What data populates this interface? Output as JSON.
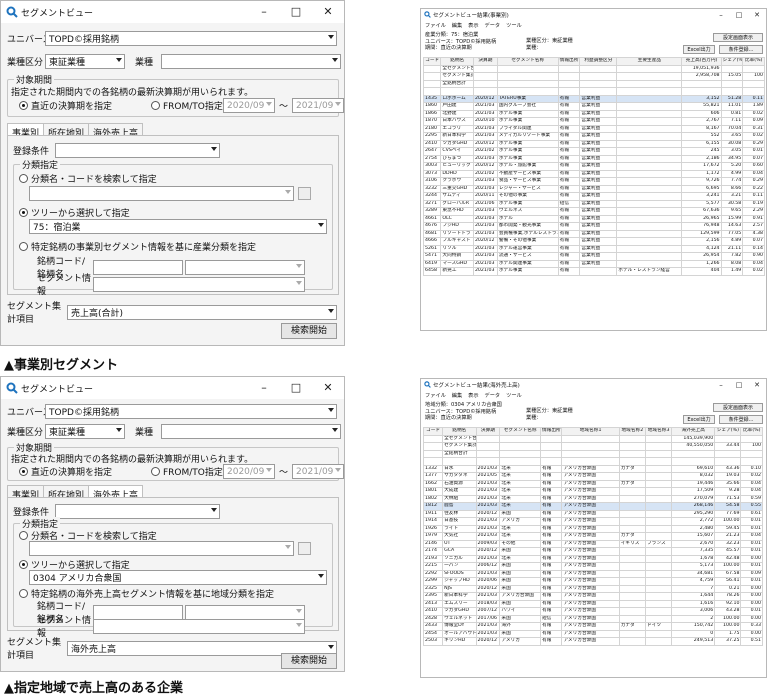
{
  "colors": {
    "window_bg": "#f4f4f4",
    "title_icon": "#1e73be",
    "selected_row": "#d6e4f5"
  },
  "icons": {
    "app": "magnifier-icon",
    "minimize": "minimize-icon",
    "maximize": "maximize-icon",
    "close": "close-icon"
  },
  "dialog1": {
    "title": "セグメントビュー",
    "universe_label": "ユニバース",
    "universe_value": "TOPD©採用銘柄",
    "sector_class_label": "業種区分",
    "sector_class_value": "東証業種",
    "sector_label": "業種",
    "sector_value": "",
    "period_group": "対象期間",
    "period_desc": "指定された期間内での各銘柄の最新決算期が用いられます。",
    "radio_latest": "直近の決算期を指定",
    "radio_fromto": "FROM/TO指定",
    "from_value": "2020/09",
    "tilde": "～",
    "to_value": "2021/09",
    "tabs": [
      "事業別",
      "所在地別",
      "海外売上高"
    ],
    "reg_cond_label": "登録条件",
    "class_group": "分類指定",
    "radio_search": "分類名・コードを検索して指定",
    "radio_tree": "ツリーから選択して指定",
    "tree_value": "75：宿泊業",
    "radio_specific": "特定銘柄の事業別セグメント情報を基に産業分類を指定",
    "code_label": "銘柄コード/銘柄名",
    "seg_info_label": "セグメント情報",
    "agg_label": "セグメント集計項目",
    "agg_value": "売上高(合計)",
    "search_button": "検索開始"
  },
  "caption1": "▲事業別セグメント",
  "dialog2": {
    "title": "セグメントビュー",
    "universe_label": "ユニバース",
    "universe_value": "TOPD©採用銘柄",
    "sector_class_label": "業種区分",
    "sector_class_value": "東証業種",
    "sector_label": "業種",
    "sector_value": "",
    "period_group": "対象期間",
    "period_desc": "指定された期間内での各銘柄の最新決算期が用いられます。",
    "radio_latest": "直近の決算期を指定",
    "radio_fromto": "FROM/TO指定",
    "from_value": "2020/09",
    "tilde": "～",
    "to_value": "2021/09",
    "tabs": [
      "事業別",
      "所在地別",
      "海外売上高"
    ],
    "reg_cond_label": "登録条件",
    "class_group": "分類指定",
    "radio_search": "分類名・コードを検索して指定",
    "radio_tree": "ツリーから選択して指定",
    "tree_value": "0304 アメリカ合衆国",
    "radio_specific": "特定銘柄の海外売上高セグメント情報を基に地域分類を指定",
    "code_label": "銘柄コード/銘柄名",
    "seg_info_label": "セグメント情報",
    "agg_label": "セグメント集計項目",
    "agg_value": "海外売上高",
    "search_button": "検索開始"
  },
  "caption2": "▲指定地域で売上高のある企業",
  "result1": {
    "title": "セグメントビュー結果(事業別)",
    "menu": [
      "ファイル",
      "編集",
      "表示",
      "データ",
      "ツール"
    ],
    "info": [
      "産業分類：75：宿泊業",
      "ユニバース：TOPD©採用銘柄",
      "期間：直近の決算期"
    ],
    "info2": [
      "業種区分：東証業種",
      "業種："
    ],
    "btn_settings": "設定画面表示",
    "btn_excel": "Excel出力",
    "btn_cond": "条件登録...",
    "header": [
      "コード",
      "銘柄名",
      "決算期",
      "セグメント名称",
      "情報出所",
      "利益調整区分",
      "主要生産品",
      "売上高(百万円)",
      "シェア(%)",
      "比率(%)"
    ],
    "summary": [
      [
        "全セグメント合計",
        "19,051,936",
        "",
        ""
      ],
      [
        "セグメント集計合計",
        "2,958,708",
        "15.05",
        "100"
      ],
      [
        "全銘柄合計",
        "",
        "",
        ""
      ]
    ],
    "rows": [
      [
        "1435",
        "ロボホーム",
        "2020/12",
        "TATERU事業",
        "有報",
        "営業利益",
        "",
        "3,152",
        "51.28",
        "0.11"
      ],
      [
        "1860",
        "戸田建",
        "2021/03",
        "国内グループ会社",
        "有報",
        "営業利益",
        "",
        "55,821",
        "11.01",
        "1.89"
      ],
      [
        "1866",
        "北野建",
        "2021/03",
        "ホテル事業",
        "有報",
        "営業利益",
        "",
        "606",
        "0.81",
        "0.02"
      ],
      [
        "1870",
        "日本ハウス",
        "2020/10",
        "ホテル事業",
        "有報",
        "営業利益",
        "",
        "2,767",
        "7.11",
        "0.09"
      ],
      [
        "2180",
        "エコラリ",
        "2021/03",
        "ブライダル関連",
        "有報",
        "営業利益",
        "",
        "8,167",
        "70.04",
        "0.31"
      ],
      [
        "2295",
        "新日本科学",
        "2021/03",
        "メディカルリゾート事業",
        "有報",
        "営業利益",
        "",
        "552",
        "3.65",
        "0.02"
      ],
      [
        "2410",
        "ツガダGHD",
        "2020/12",
        "ホテル事業",
        "有報",
        "営業利益",
        "",
        "6,155",
        "30.08",
        "0.29"
      ],
      [
        "2647",
        "CVSベイ",
        "2021/02",
        "ホテル事業",
        "有報",
        "営業利益",
        "",
        "245",
        "3.05",
        "0.01"
      ],
      [
        "2754",
        "ひらまつ",
        "2021/03",
        "ホテル事業",
        "有報",
        "営業利益",
        "",
        "2,186",
        "34.95",
        "0.07"
      ],
      [
        "3003",
        "ヒューリック",
        "2020/12",
        "ホテル・旅館事業",
        "有報",
        "営業利益",
        "",
        "17,672",
        "5.20",
        "0.60"
      ],
      [
        "3073",
        "DDHD",
        "2021/02",
        "不動産サービス事業",
        "有報",
        "営業利益",
        "",
        "1,172",
        "4.99",
        "0.04"
      ],
      [
        "3106",
        "クラボウ",
        "2021/03",
        "食品・サービス事業",
        "有報",
        "営業利益",
        "",
        "9,726",
        "7.74",
        "0.29"
      ],
      [
        "3232",
        "三重交GHD",
        "2021/03",
        "レジャー・サービス",
        "有報",
        "営業利益",
        "",
        "6,695",
        "8.66",
        "0.22"
      ],
      [
        "3244",
        "サムティ",
        "2020/11",
        "その他の事業",
        "有報",
        "営業利益",
        "",
        "3,241",
        "3.21",
        "0.11"
      ],
      [
        "3271",
        "グローバルR",
        "2021/06",
        "ホテル事業",
        "短信",
        "営業利益",
        "",
        "5,577",
        "30.58",
        "0.19"
      ],
      [
        "3289",
        "東急不HD",
        "2021/03",
        "ウェルネス",
        "有報",
        "営業利益",
        "",
        "67,636",
        "9.65",
        "2.29"
      ],
      [
        "4661",
        "OLC",
        "2021/03",
        "ホテル",
        "有報",
        "営業利益",
        "",
        "26,965",
        "15.99",
        "0.91"
      ],
      [
        "4676",
        "フジHD",
        "2021/03",
        "都市開発・観光事業",
        "有報",
        "営業利益",
        "",
        "76,948",
        "14.63",
        "2.57"
      ],
      [
        "4681",
        "リゾートトラ",
        "2021/03",
        "会員権事業,ホテルレストラン",
        "有報",
        "営業利益",
        "",
        "129,599",
        "77.05",
        "4.38"
      ],
      [
        "4666",
        "フルキャスト",
        "2020/12",
        "警備・その他事業",
        "有報",
        "営業利益",
        "",
        "2,156",
        "4.89",
        "0.07"
      ],
      [
        "5261",
        "リソル",
        "2021/03",
        "ホテル運営事業",
        "有報",
        "営業利益",
        "",
        "4,124",
        "21.11",
        "0.14"
      ],
      [
        "5471",
        "大同特鋼",
        "2021/03",
        "流通・サービス",
        "有報",
        "営業利益",
        "",
        "26,954",
        "7.82",
        "0.90"
      ],
      [
        "6419",
        "マースGHD",
        "2021/03",
        "ホテル関連事業",
        "有報",
        "営業利益",
        "",
        "1,266",
        "8.08",
        "0.04"
      ],
      [
        "6458",
        "新晃工",
        "2021/03",
        "ホテル事業",
        "有報",
        "",
        "ホテル・レストラン経営",
        "404",
        "1.49",
        "0.02"
      ]
    ]
  },
  "result2": {
    "title": "セグメントビュー結果(海外売上高)",
    "menu": [
      "ファイル",
      "編集",
      "表示",
      "データ",
      "ツール"
    ],
    "info": [
      "地域分類：0304 アメリカ合衆国",
      "ユニバース：TOPD©採用銘柄",
      "期間：直近の決算期"
    ],
    "info2": [
      "業種区分：東証業種",
      "業種："
    ],
    "btn_settings": "設定画面表示",
    "btn_excel": "Excel出力",
    "btn_cond": "条件登録...",
    "header": [
      "コード",
      "銘柄名",
      "決算期",
      "セグメント名称",
      "情報出所",
      "地域名称1",
      "地域名称2",
      "地域名称3",
      "海外売上高",
      "シェア(%)",
      "比率(%)"
    ],
    "summary": [
      [
        "全セグメント合計",
        "145,039,900",
        "",
        ""
      ],
      [
        "セグメント集計合計",
        "40,550,050",
        "33.44",
        "100"
      ],
      [
        "全銘柄合計",
        "",
        "",
        ""
      ]
    ],
    "rows": [
      [
        "1332",
        "日水",
        "2021/03",
        "北米",
        "有報",
        "アメリカ合衆国",
        "カナダ",
        "",
        "69,610",
        "43.36",
        "0.10"
      ],
      [
        "1377",
        "サカタタネ",
        "2021/05",
        "北米",
        "有報",
        "アメリカ合衆国",
        "",
        "",
        "8,032",
        "19.03",
        "0.02"
      ],
      [
        "1662",
        "石油資源",
        "2021/03",
        "北米",
        "有報",
        "アメリカ合衆国",
        "カナダ",
        "",
        "19,446",
        "35.66",
        "0.04"
      ],
      [
        "1801",
        "大成建",
        "2021/03",
        "北米",
        "有報",
        "アメリカ合衆国",
        "",
        "",
        "17,509",
        "9.28",
        "0.04"
      ],
      [
        "1802",
        "大林組",
        "2021/03",
        "北米",
        "有報",
        "アメリカ合衆国",
        "",
        "",
        "270,079",
        "71.53",
        "0.59"
      ],
      [
        "1812",
        "鹿島",
        "2021/03",
        "北米",
        "有報",
        "アメリカ合衆国",
        "",
        "",
        "268,146",
        "54.58",
        "0.55"
      ],
      [
        "1911",
        "住友林",
        "2020/12",
        "米国",
        "有報",
        "アメリカ合衆国",
        "",
        "",
        "295,290",
        "77.69",
        "0.61"
      ],
      [
        "1914",
        "日基技",
        "2021/03",
        "アメリカ",
        "有報",
        "アメリカ合衆国",
        "",
        "",
        "2,772",
        "100.00",
        "0.01"
      ],
      [
        "1926",
        "ライト",
        "2021/03",
        "北米",
        "有報",
        "アメリカ合衆国",
        "",
        "",
        "2,480",
        "59.45",
        "0.01"
      ],
      [
        "1979",
        "大気社",
        "2021/03",
        "北米",
        "有報",
        "アメリカ合衆国",
        "カナダ",
        "",
        "15,607",
        "21.23",
        "0.04"
      ],
      [
        "2146",
        "UT",
        "2009/03",
        "その他",
        "有報",
        "アメリカ合衆国",
        "イギリス",
        "フランス",
        "2,670",
        "32.23",
        "0.01"
      ],
      [
        "2174",
        "GCA",
        "2020/12",
        "米国",
        "有報",
        "アメリカ合衆国",
        "",
        "",
        "7,335",
        "45.57",
        "0.01"
      ],
      [
        "2193",
        "ソニカル",
        "2021/03",
        "北米",
        "有報",
        "アメリカ合衆国",
        "",
        "",
        "1,678",
        "42.48",
        "0.00"
      ],
      [
        "2215",
        "一パン",
        "2006/12",
        "米国",
        "有報",
        "アメリカ合衆国",
        "",
        "",
        "5,173",
        "100.00",
        "0.01"
      ],
      [
        "2292",
        "SFOODS",
        "2021/03",
        "米国",
        "有報",
        "アメリカ合衆国",
        "",
        "",
        "34,681",
        "67.58",
        "0.09"
      ],
      [
        "2299",
        "ジャップHD",
        "2020/06",
        "米国",
        "有報",
        "アメリカ合衆国",
        "",
        "",
        "4,759",
        "56.41",
        "0.01"
      ],
      [
        "2325",
        "NJS",
        "2020/12",
        "米国",
        "有報",
        "アメリカ合衆国",
        "",
        "",
        "7",
        "0.21",
        "0.00"
      ],
      [
        "2395",
        "新日本科学",
        "2021/03",
        "アメリカ合衆国",
        "有報",
        "アメリカ合衆国",
        "",
        "",
        "1,644",
        "78.26",
        "0.00"
      ],
      [
        "2413",
        "エムスリー",
        "2018/03",
        "米国",
        "有報",
        "アメリカ合衆国",
        "",
        "",
        "1,616",
        "92.10",
        "0.00"
      ],
      [
        "2410",
        "ツガダGHD",
        "2007/12",
        "ハワイ",
        "有報",
        "アメリカ合衆国",
        "",
        "",
        "3,006",
        "43.28",
        "0.01"
      ],
      [
        "2428",
        "ウェルネット",
        "2017/06",
        "米国",
        "短信",
        "アメリカ合衆国",
        "",
        "",
        "2",
        "100.00",
        "0.00"
      ],
      [
        "2433",
        "博報堂DY",
        "2021/03",
        "海外",
        "有報",
        "アメリカ合衆国",
        "カナダ",
        "ドイツ",
        "150,742",
        "100.00",
        "0.33"
      ],
      [
        "2454",
        "オールアバウト",
        "2021/03",
        "米国",
        "有報",
        "アメリカ合衆国",
        "",
        "",
        "0",
        "1.75",
        "0.00"
      ],
      [
        "2503",
        "キリンHD",
        "2020/12",
        "アメリカ",
        "有報",
        "アメリカ合衆国",
        "",
        "",
        "249,513",
        "37.25",
        "0.51"
      ]
    ]
  }
}
